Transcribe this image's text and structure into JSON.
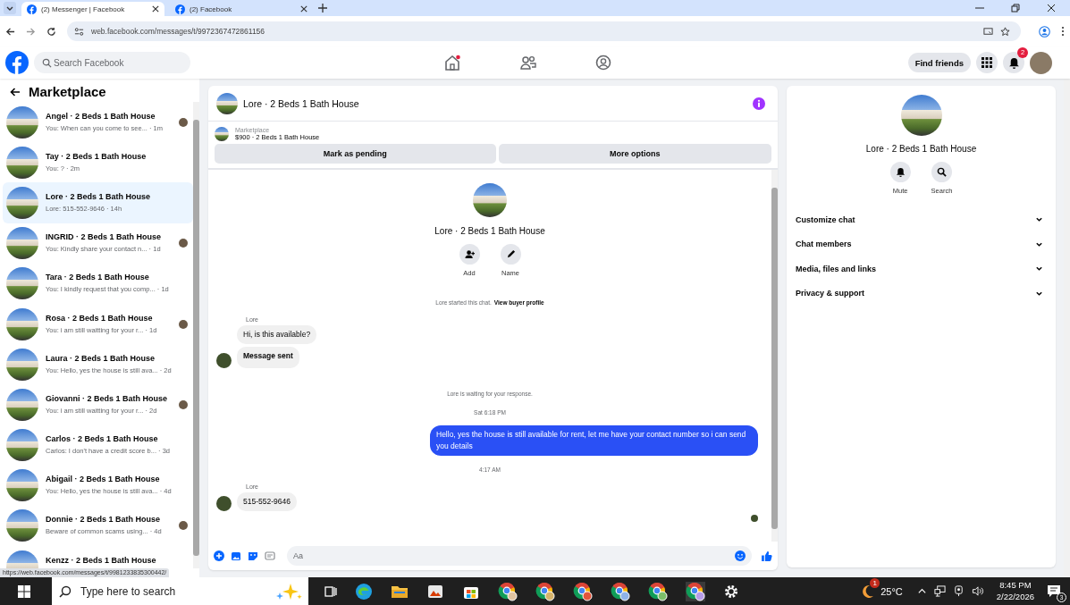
{
  "browser": {
    "tabs": [
      {
        "title": "(2) Messenger | Facebook",
        "selected": true
      },
      {
        "title": "(2) Facebook",
        "selected": false
      }
    ],
    "url": "web.facebook.com/messages/t/9972367472861156"
  },
  "header": {
    "search_placeholder": "Search Facebook",
    "find_friends": "Find friends",
    "notification_count": "2"
  },
  "sidebar": {
    "title": "Marketplace",
    "conversations": [
      {
        "name": "Angel · 2 Beds 1 Bath House",
        "preview": "You: When can you come to see... · 1m",
        "selected": false,
        "seen": true
      },
      {
        "name": "Tay · 2 Beds 1 Bath House",
        "preview": "You: ? · 2m",
        "selected": false,
        "seen": false
      },
      {
        "name": "Lore · 2 Beds 1 Bath House",
        "preview": "Lore: 515-552-9646 · 14h",
        "selected": true,
        "seen": false
      },
      {
        "name": "INGRID · 2 Beds 1 Bath House",
        "preview": "You: Kindly share your contact n... · 1d",
        "selected": false,
        "seen": true
      },
      {
        "name": "Tara · 2 Beds 1 Bath House",
        "preview": "You: I kindly request that you comp... · 1d",
        "selected": false,
        "seen": false
      },
      {
        "name": "Rosa · 2 Beds 1 Bath House",
        "preview": "You: i am still waitting for your r... · 1d",
        "selected": false,
        "seen": true
      },
      {
        "name": "Laura · 2 Beds 1 Bath House",
        "preview": "You: Hello, yes the house is still ava... · 2d",
        "selected": false,
        "seen": false
      },
      {
        "name": "Giovanni · 2 Beds 1 Bath House",
        "preview": "You: i am still waitting for your r... · 2d",
        "selected": false,
        "seen": true
      },
      {
        "name": "Carlos · 2 Beds 1 Bath House",
        "preview": "Carlos: I don't have a credit score b... · 3d",
        "selected": false,
        "seen": false
      },
      {
        "name": "Abigail · 2 Beds 1 Bath House",
        "preview": "You: Hello, yes the house is still ava... · 4d",
        "selected": false,
        "seen": false
      },
      {
        "name": "Donnie · 2 Beds 1 Bath House",
        "preview": "Beware of common scams using... · 4d",
        "selected": false,
        "seen": true
      },
      {
        "name": "Kenzz · 2 Beds 1 Bath House",
        "selected": false,
        "seen": false
      }
    ]
  },
  "chat": {
    "title": "Lore · 2 Beds 1 Bath House",
    "listing": {
      "label": "Marketplace",
      "detail": "$900 · 2 Beds 1 Bath House"
    },
    "buttons": [
      "Mark as pending",
      "More options"
    ],
    "profile": {
      "name": "Lore · 2 Beds 1 Bath House",
      "actions": [
        {
          "kind": "add",
          "label": "Add"
        },
        {
          "kind": "edit",
          "label": "Name"
        }
      ]
    },
    "messages": [
      {
        "kind": "system",
        "text": "Lore started this chat.",
        "link": "View buyer profile"
      },
      {
        "kind": "incoming",
        "sender": "Lore",
        "bubbles": [
          {
            "kind": "text",
            "text": "Hi, is this available?"
          },
          {
            "kind": "notice",
            "text": "Message sent"
          }
        ]
      },
      {
        "kind": "system",
        "text": "Lore is waiting for your response."
      },
      {
        "kind": "time",
        "text": "Sat 6:18 PM"
      },
      {
        "kind": "outgoing",
        "text": "Hello, yes the house is still available for rent, let me have your contact number so i can send you  details"
      },
      {
        "kind": "time",
        "text": "4:17 AM"
      },
      {
        "kind": "incoming",
        "sender": "Lore",
        "bubbles": [
          {
            "kind": "text",
            "text": "515-552-9646"
          }
        ]
      }
    ],
    "composer_placeholder": "Aa"
  },
  "details": {
    "name": "Lore · 2 Beds 1 Bath House",
    "actions": [
      {
        "kind": "mute",
        "label": "Mute"
      },
      {
        "kind": "search",
        "label": "Search"
      }
    ],
    "sections": [
      "Customize chat",
      "Chat members",
      "Media, files and links",
      "Privacy & support"
    ]
  },
  "status_url": "https://web.facebook.com/messages/t/9981233835300442/",
  "taskbar": {
    "search_placeholder": "Type here to search",
    "weather_badge": "1",
    "temperature": "25°C",
    "time": "8:45 PM",
    "date": "2/22/2026",
    "notification_count": "3"
  }
}
